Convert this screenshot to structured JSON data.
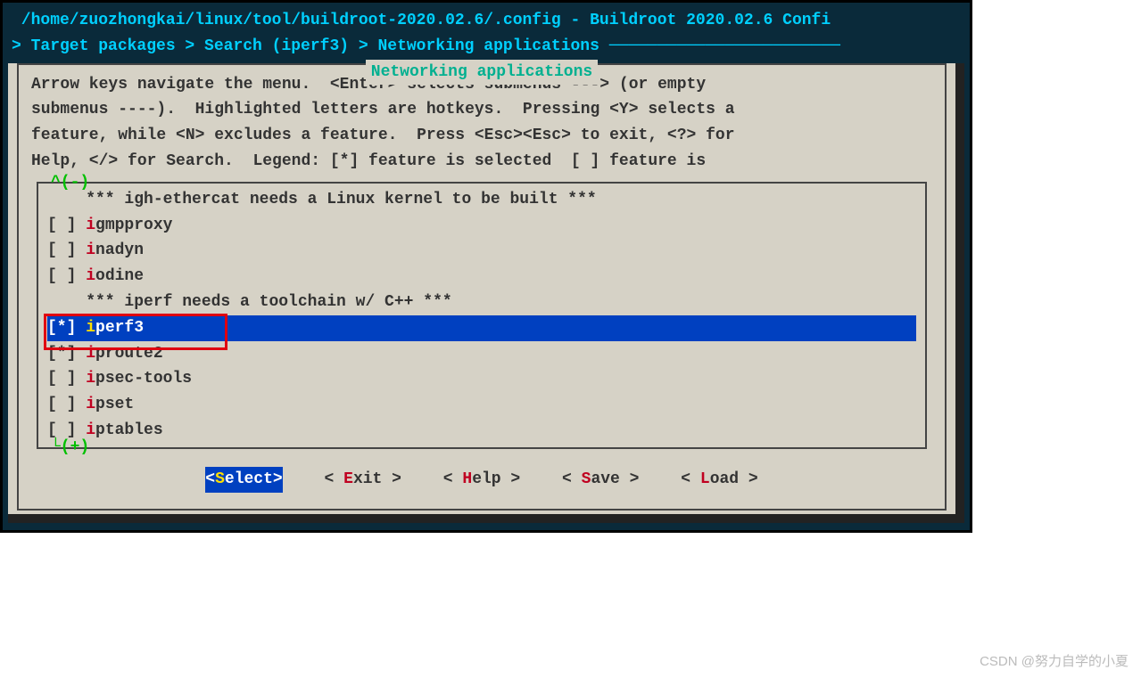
{
  "title_line1": " /home/zuozhongkai/linux/tool/buildroot-2020.02.6/.config - Buildroot 2020.02.6 Confi",
  "title_line2_prefix": "> Target packages > Search (iperf3) > Networking applications ",
  "dialog_title": " Networking applications ",
  "help_text": "Arrow keys navigate the menu.  <Enter> selects submenus ---> (or empty\nsubmenus ----).  Highlighted letters are hotkeys.  Pressing <Y> selects a\nfeature, while <N> excludes a feature.  Press <Esc><Esc> to exit, <?> for\nHelp, </> for Search.  Legend: [*] feature is selected  [ ] feature is",
  "scroll_up": "^(-)",
  "scroll_down": "└(+)",
  "items": [
    {
      "type": "comment",
      "text": "    *** igh-ethercat needs a Linux kernel to be built ***"
    },
    {
      "type": "opt",
      "state": " ",
      "hk": "i",
      "rest": "gmpproxy"
    },
    {
      "type": "opt",
      "state": " ",
      "hk": "i",
      "rest": "nadyn"
    },
    {
      "type": "opt",
      "state": " ",
      "hk": "i",
      "rest": "odine"
    },
    {
      "type": "comment",
      "text": "    *** iperf needs a toolchain w/ C++ ***"
    },
    {
      "type": "opt",
      "state": "*",
      "hk": "i",
      "rest": "perf3",
      "selected": true,
      "highlighted": true
    },
    {
      "type": "opt",
      "state": "*",
      "hk": "i",
      "rest": "proute2"
    },
    {
      "type": "opt",
      "state": " ",
      "hk": "i",
      "rest": "psec-tools"
    },
    {
      "type": "opt",
      "state": " ",
      "hk": "i",
      "rest": "pset"
    },
    {
      "type": "opt",
      "state": " ",
      "hk": "i",
      "rest": "ptables"
    }
  ],
  "buttons": {
    "select": "Select",
    "exit": "Exit",
    "help": "Help",
    "save": "Save",
    "load": "Load"
  },
  "watermark": "CSDN @努力自学的小夏"
}
